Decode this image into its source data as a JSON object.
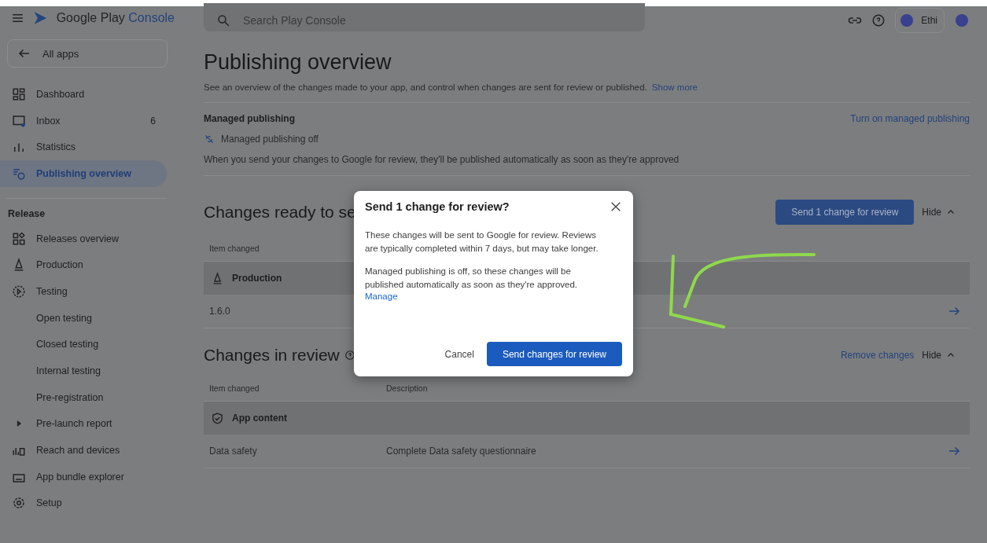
{
  "header": {
    "brand_word": "Google Play",
    "brand_accent": "Console",
    "search_placeholder": "Search Play Console",
    "account_name": "Ethi"
  },
  "sidebar": {
    "back_label": "All apps",
    "items": [
      {
        "label": "Dashboard",
        "selected": false
      },
      {
        "label": "Inbox",
        "badge": "6",
        "selected": false
      },
      {
        "label": "Statistics",
        "selected": false
      },
      {
        "label": "Publishing overview",
        "selected": true
      }
    ],
    "section": {
      "title": "Release",
      "items": [
        {
          "label": "Releases overview",
          "selected": false
        },
        {
          "label": "Production",
          "selected": false
        },
        {
          "label": "Testing",
          "selected": false,
          "expanded": true,
          "children": [
            {
              "label": "Open testing",
              "selected": false
            },
            {
              "label": "Closed testing",
              "selected": false
            },
            {
              "label": "Internal testing",
              "selected": false
            },
            {
              "label": "Pre-registration",
              "selected": false
            }
          ]
        },
        {
          "label": "Pre-launch report",
          "selected": false,
          "expanded": false
        },
        {
          "label": "Reach and devices",
          "selected": false
        },
        {
          "label": "App bundle explorer",
          "selected": false
        },
        {
          "label": "Setup",
          "selected": false
        }
      ]
    }
  },
  "page": {
    "title": "Publishing overview",
    "intro": "See an overview of the changes made to your app, and control when changes are sent for review or published.",
    "intro_link": "Show more",
    "managed": {
      "title": "Managed publishing",
      "action": "Turn on managed publishing",
      "status": "Managed publishing off",
      "note": "When you send your changes to Google for review, they'll be published automatically as soon as they're approved"
    },
    "sections": [
      {
        "title": "Changes ready to se",
        "help": false,
        "primary_action": "Send 1 change for review",
        "hide": "Hide",
        "columns": [
          "Item changed"
        ],
        "group": {
          "label": "Production"
        },
        "rows": [
          {
            "item": "1.6.0"
          }
        ]
      },
      {
        "title": "Changes in review",
        "help": true,
        "link_action": "Remove changes",
        "hide": "Hide",
        "columns": [
          "Item changed",
          "Description"
        ],
        "group": {
          "label": "App content"
        },
        "rows": [
          {
            "item": "Data safety",
            "description": "Complete Data safety questionnaire"
          }
        ]
      }
    ]
  },
  "dialog": {
    "title": "Send 1 change for review?",
    "paragraphs": [
      "These changes will be sent to Google for review. Reviews are typically completed within 7 days, but may take longer.",
      "Managed publishing is off, so these changes will be published automatically as soon as they're approved."
    ],
    "link": "Manage",
    "cancel": "Cancel",
    "confirm": "Send changes for review"
  }
}
